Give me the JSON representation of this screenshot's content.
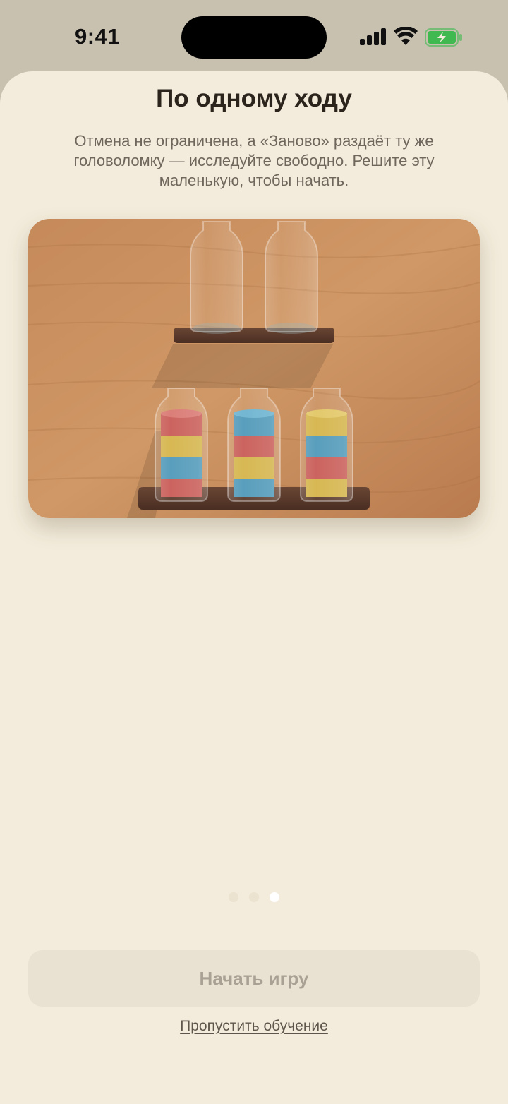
{
  "status_bar": {
    "time": "9:41",
    "icons": [
      "cellular-signal-icon",
      "wifi-icon",
      "battery-charging-icon"
    ],
    "battery_color": "#3fb950"
  },
  "onboarding": {
    "title": "По одному ходу",
    "subtitle": "Отмена не ограничена, а «Заново» раздаёт ту же головоломку — исследуйте свободно. Решите эту маленькую, чтобы начать.",
    "illustration": {
      "description_icon": "bottle-puzzle-illustration",
      "top_shelf_bottles": 2,
      "bottom_shelf_bottles": [
        {
          "layers_top_to_bottom": [
            "red",
            "yellow",
            "blue",
            "red"
          ]
        },
        {
          "layers_top_to_bottom": [
            "blue",
            "red",
            "yellow",
            "blue"
          ]
        },
        {
          "layers_top_to_bottom": [
            "yellow",
            "blue",
            "red",
            "yellow"
          ]
        }
      ],
      "colors": {
        "red": "#c85a55",
        "yellow": "#d4b348",
        "blue": "#4e98b8",
        "wood": "#c98d5c",
        "shelf": "#5a3a2c"
      }
    },
    "pager": {
      "count": 3,
      "active_index": 2
    },
    "start_button_label": "Начать игру",
    "skip_link_label": "Пропустить обучение"
  },
  "colors": {
    "sheet_background": "#f3ecdc",
    "title": "#2b241d",
    "subtitle": "#6f675c",
    "button_background": "#e9e1d1",
    "button_text": "#aaa195"
  }
}
